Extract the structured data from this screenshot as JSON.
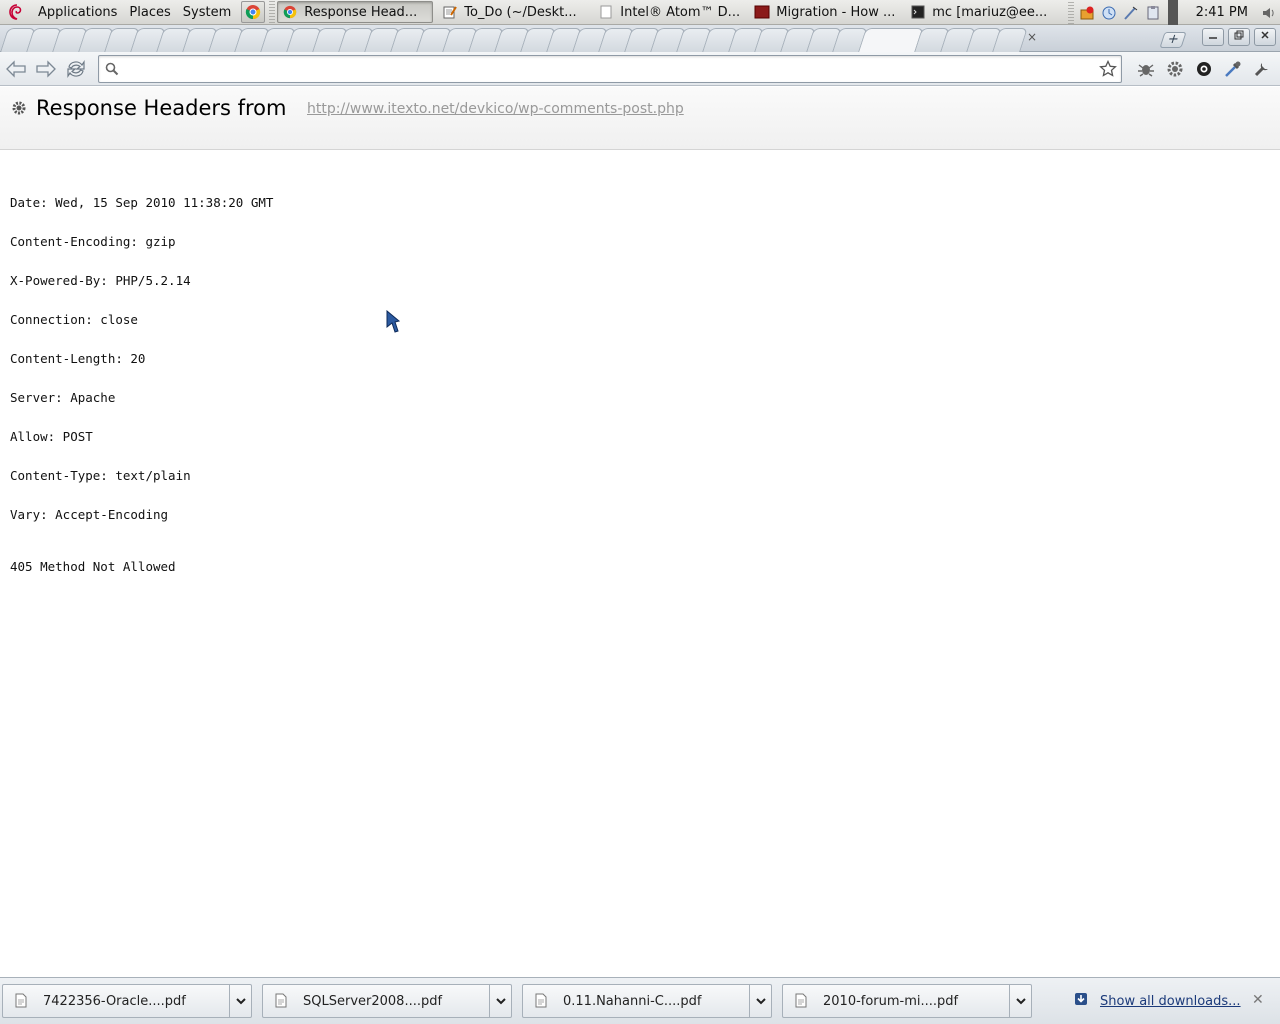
{
  "panel": {
    "menus": [
      "Applications",
      "Places",
      "System"
    ],
    "tasks": [
      {
        "label": "Response Head...",
        "active": true
      },
      {
        "label": "To_Do (~/Deskt...",
        "active": false
      },
      {
        "label": "Intel® Atom™ D...",
        "active": false
      },
      {
        "label": "Migration - How ...",
        "active": false
      },
      {
        "label": "mc [mariuz@ee...",
        "active": false
      }
    ],
    "clock": "2:41 PM"
  },
  "browser": {
    "omnibox_value": "",
    "tab_close": "×",
    "new_tab": "+"
  },
  "page": {
    "title": "Response Headers from",
    "url": "http://www.itexto.net/devkico/wp-comments-post.php",
    "headers": [
      "Date: Wed, 15 Sep 2010 11:38:20 GMT",
      "Content-Encoding: gzip",
      "X-Powered-By: PHP/5.2.14",
      "Connection: close",
      "Content-Length: 20",
      "Server: Apache",
      "Allow: POST",
      "Content-Type: text/plain",
      "Vary: Accept-Encoding"
    ],
    "status": "405 Method Not Allowed"
  },
  "downloads": {
    "items": [
      {
        "name": "7422356-Oracle....pdf"
      },
      {
        "name": "SQLServer2008....pdf"
      },
      {
        "name": "0.11.Nahanni-C....pdf"
      },
      {
        "name": "2010-forum-mi....pdf"
      }
    ],
    "show_all": "Show all downloads...",
    "close": "✕"
  }
}
